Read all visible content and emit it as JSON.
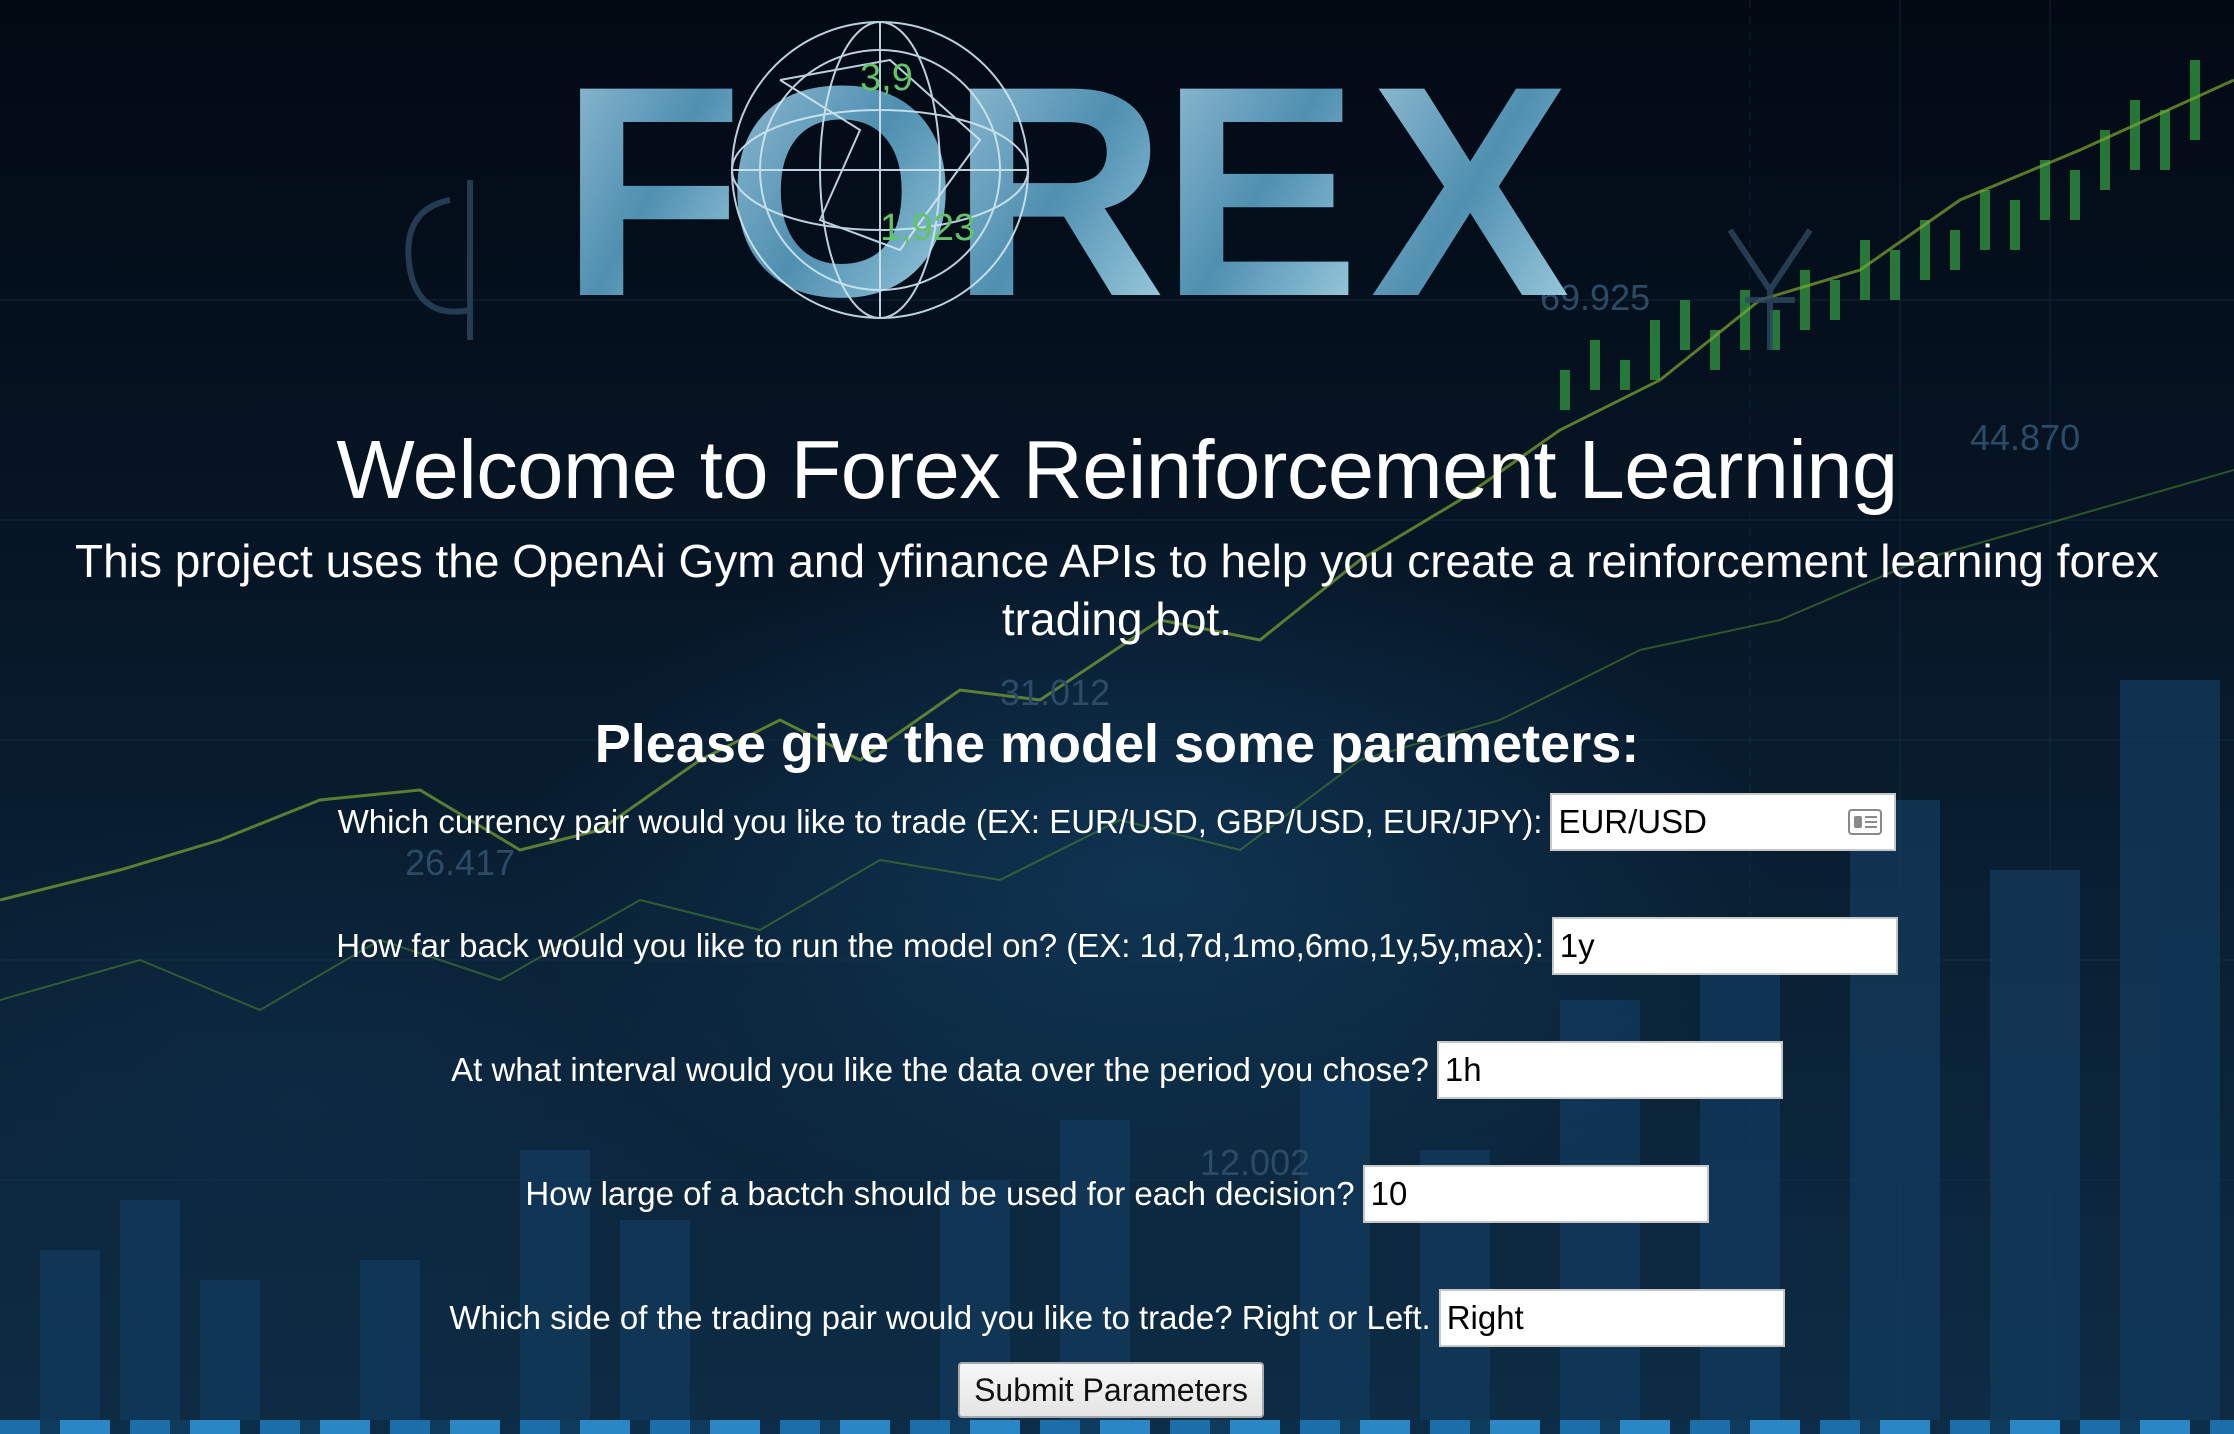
{
  "logo": {
    "letters": [
      "F",
      "O",
      "R",
      "E",
      "X"
    ],
    "overlay_numbers": [
      "3,9",
      "1,923"
    ]
  },
  "background": {
    "numbers": [
      "44.870",
      "31.012",
      "26.417",
      "12.002",
      "69.925"
    ]
  },
  "header": {
    "title": "Welcome to Forex Reinforcement Learning",
    "subtitle": "This project uses the OpenAi Gym and yfinance APIs to help you create a reinforcement learning forex trading bot."
  },
  "form": {
    "heading": "Please give the model some parameters:",
    "fields": [
      {
        "label": "Which currency pair would you like to trade (EX: EUR/USD, GBP/USD, EUR/JPY):",
        "value": "EUR/USD",
        "icon": "contact-card-icon"
      },
      {
        "label": "How far back would you like to run the model on? (EX: 1d,7d,1mo,6mo,1y,5y,max):",
        "value": "1y"
      },
      {
        "label": "At what interval would you like the data over the period you chose?",
        "value": "1h"
      },
      {
        "label": "How large of a bactch should be used for each decision?",
        "value": "10"
      },
      {
        "label": "Which side of the trading pair would you like to trade? Right or Left.",
        "value": "Right"
      }
    ],
    "submit_label": "Submit Parameters"
  },
  "colors": {
    "background": "#06121f",
    "text": "#ffffff",
    "chart_line": "#9cbf3a",
    "chart_bars": "#2a86c4"
  }
}
